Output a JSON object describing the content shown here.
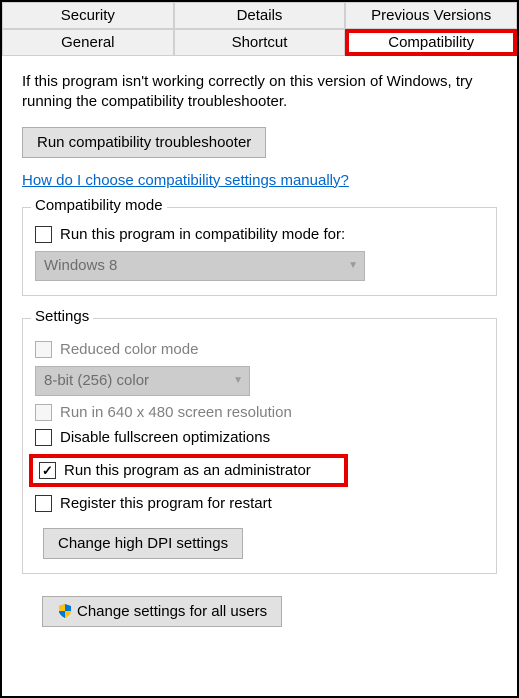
{
  "tabs": {
    "row1": [
      "Security",
      "Details",
      "Previous Versions"
    ],
    "row2": [
      "General",
      "Shortcut",
      "Compatibility"
    ]
  },
  "intro": "If this program isn't working correctly on this version of Windows, try running the compatibility troubleshooter.",
  "troubleshooter_btn": "Run compatibility troubleshooter",
  "help_link": "How do I choose compatibility settings manually?",
  "compat_mode": {
    "legend": "Compatibility mode",
    "checkbox_label": "Run this program in compatibility mode for:",
    "select_value": "Windows 8"
  },
  "settings": {
    "legend": "Settings",
    "reduced_color": "Reduced color mode",
    "color_select": "8-bit (256) color",
    "low_res": "Run in 640 x 480 screen resolution",
    "disable_fullscreen": "Disable fullscreen optimizations",
    "run_admin": "Run this program as an administrator",
    "register_restart": "Register this program for restart",
    "change_dpi_btn": "Change high DPI settings"
  },
  "all_users_btn": "Change settings for all users"
}
